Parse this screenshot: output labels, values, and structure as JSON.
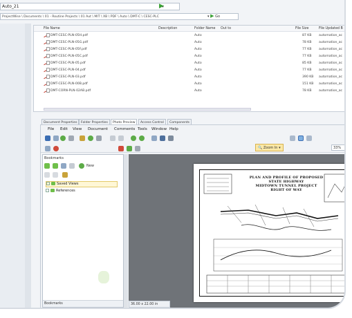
{
  "top_path": {
    "value": "Auto_21"
  },
  "address": {
    "value": "ProjectWise \\ Documents \\ 01 - Routine Projects \\ 01 Aut \\ MIT \\ XB \\ PDF \\ Auto \\ DMT-C \\ CESC-PLC",
    "go_label": "Go"
  },
  "file_list": {
    "columns": [
      "File Name",
      "Description",
      "Folder Name",
      "Out to",
      "File Size",
      "File Updated B"
    ],
    "rows": [
      {
        "name": "DMT-CESC-PLN-05H.pdf",
        "folder": "Auto",
        "size": "87 KB",
        "updated_by": "automation_ac"
      },
      {
        "name": "DMT-CESC-PLN-05G.pdf",
        "folder": "Auto",
        "size": "78 KB",
        "updated_by": "automation_ac"
      },
      {
        "name": "DMT-CESC-PLN-05F.pdf",
        "folder": "Auto",
        "size": "77 KB",
        "updated_by": "automation_ac"
      },
      {
        "name": "DMT-CESC-PLN-05C.pdf",
        "folder": "Auto",
        "size": "77 KB",
        "updated_by": "automation_ac"
      },
      {
        "name": "DMT-CESC-PLN-05.pdf",
        "folder": "Auto",
        "size": "85 KB",
        "updated_by": "automation_ac"
      },
      {
        "name": "DMT-CESC-PLN-04.pdf",
        "folder": "Auto",
        "size": "77 KB",
        "updated_by": "automation_ac"
      },
      {
        "name": "DMT-CESC-PLN-03.pdf",
        "folder": "Auto",
        "size": "390 KB",
        "updated_by": "automation_ac"
      },
      {
        "name": "DMT-CESC-PLN-00B.pdf",
        "folder": "Auto",
        "size": "151 KB",
        "updated_by": "automation_ac"
      },
      {
        "name": "DMT-CORN-PLN-02AB.pdf",
        "folder": "Auto",
        "size": "78 KB",
        "updated_by": "automation_ac"
      }
    ]
  },
  "tabs": [
    "Document Properties",
    "Folder Properties",
    "Photo Preview",
    "Access Control",
    "Components"
  ],
  "menu": [
    "File",
    "Edit",
    "View",
    "Document",
    "Comments",
    "Tools",
    "Window",
    "Help"
  ],
  "toolbar": {
    "zoom_in_label": "Zoom In",
    "zoom_value": "33%"
  },
  "bookmarks": {
    "title": "Bookmarks",
    "new_label": "New",
    "items": [
      "Saved Views",
      "References"
    ],
    "footer": "Bookmarks"
  },
  "document": {
    "title_lines": [
      "PLAN AND PROFILE OF PROPOSED",
      "STATE HIGHWAY",
      "MIDTOWN TUNNEL PROJECT",
      "RIGHT OF WAY"
    ],
    "page_size": "36.00 x 22.00 in"
  },
  "colors": {
    "accent_green": "#3aa135",
    "selection_yellow": "#fbe8a6",
    "pdf_red": "#c0392b"
  }
}
